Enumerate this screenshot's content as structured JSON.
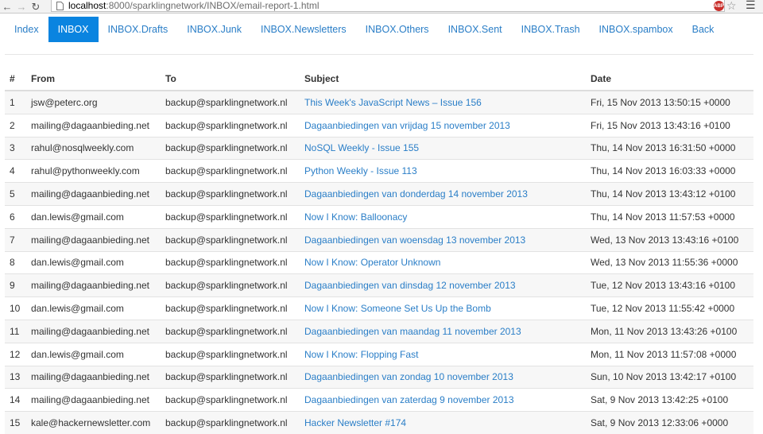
{
  "browser": {
    "url_host": "localhost",
    "url_path": ":8000/sparklingnetwork/INBOX/email-report-1.html",
    "adblock_label": "ABP",
    "colors": {
      "adblock": "#c9302c"
    },
    "icons": [
      "back-arrow-icon",
      "forward-arrow-icon",
      "reload-icon",
      "page-icon",
      "bookmark-star-icon",
      "menu-icon"
    ]
  },
  "tabs": [
    {
      "label": "Index",
      "active": false
    },
    {
      "label": "INBOX",
      "active": true
    },
    {
      "label": "INBOX.Drafts",
      "active": false
    },
    {
      "label": "INBOX.Junk",
      "active": false
    },
    {
      "label": "INBOX.Newsletters",
      "active": false
    },
    {
      "label": "INBOX.Others",
      "active": false
    },
    {
      "label": "INBOX.Sent",
      "active": false
    },
    {
      "label": "INBOX.Trash",
      "active": false
    },
    {
      "label": "INBOX.spambox",
      "active": false
    },
    {
      "label": "Back",
      "active": false
    }
  ],
  "colors": {
    "active_tab": "#0a84e0",
    "link": "#2a7ec7"
  },
  "table": {
    "headers": {
      "num": "#",
      "from": "From",
      "to": "To",
      "subject": "Subject",
      "date": "Date"
    },
    "rows": [
      {
        "num": "1",
        "from": "jsw@peterc.org",
        "to": "backup@sparklingnetwork.nl",
        "subject": "This Week's JavaScript News – Issue 156",
        "date": "Fri, 15 Nov 2013 13:50:15 +0000"
      },
      {
        "num": "2",
        "from": "mailing@dagaanbieding.net",
        "to": "backup@sparklingnetwork.nl",
        "subject": "Dagaanbiedingen van vrijdag 15 november 2013",
        "date": "Fri, 15 Nov 2013 13:43:16 +0100"
      },
      {
        "num": "3",
        "from": "rahul@nosqlweekly.com",
        "to": "backup@sparklingnetwork.nl",
        "subject": "NoSQL Weekly - Issue 155",
        "date": "Thu, 14 Nov 2013 16:31:50 +0000"
      },
      {
        "num": "4",
        "from": "rahul@pythonweekly.com",
        "to": "backup@sparklingnetwork.nl",
        "subject": "Python Weekly - Issue 113",
        "date": "Thu, 14 Nov 2013 16:03:33 +0000"
      },
      {
        "num": "5",
        "from": "mailing@dagaanbieding.net",
        "to": "backup@sparklingnetwork.nl",
        "subject": "Dagaanbiedingen van donderdag 14 november 2013",
        "date": "Thu, 14 Nov 2013 13:43:12 +0100"
      },
      {
        "num": "6",
        "from": "dan.lewis@gmail.com",
        "to": "backup@sparklingnetwork.nl",
        "subject": "Now I Know: Balloonacy",
        "date": "Thu, 14 Nov 2013 11:57:53 +0000"
      },
      {
        "num": "7",
        "from": "mailing@dagaanbieding.net",
        "to": "backup@sparklingnetwork.nl",
        "subject": "Dagaanbiedingen van woensdag 13 november 2013",
        "date": "Wed, 13 Nov 2013 13:43:16 +0100"
      },
      {
        "num": "8",
        "from": "dan.lewis@gmail.com",
        "to": "backup@sparklingnetwork.nl",
        "subject": "Now I Know: Operator Unknown",
        "date": "Wed, 13 Nov 2013 11:55:36 +0000"
      },
      {
        "num": "9",
        "from": "mailing@dagaanbieding.net",
        "to": "backup@sparklingnetwork.nl",
        "subject": "Dagaanbiedingen van dinsdag 12 november 2013",
        "date": "Tue, 12 Nov 2013 13:43:16 +0100"
      },
      {
        "num": "10",
        "from": "dan.lewis@gmail.com",
        "to": "backup@sparklingnetwork.nl",
        "subject": "Now I Know: Someone Set Us Up the Bomb",
        "date": "Tue, 12 Nov 2013 11:55:42 +0000"
      },
      {
        "num": "11",
        "from": "mailing@dagaanbieding.net",
        "to": "backup@sparklingnetwork.nl",
        "subject": "Dagaanbiedingen van maandag 11 november 2013",
        "date": "Mon, 11 Nov 2013 13:43:26 +0100"
      },
      {
        "num": "12",
        "from": "dan.lewis@gmail.com",
        "to": "backup@sparklingnetwork.nl",
        "subject": "Now I Know: Flopping Fast",
        "date": "Mon, 11 Nov 2013 11:57:08 +0000"
      },
      {
        "num": "13",
        "from": "mailing@dagaanbieding.net",
        "to": "backup@sparklingnetwork.nl",
        "subject": "Dagaanbiedingen van zondag 10 november 2013",
        "date": "Sun, 10 Nov 2013 13:42:17 +0100"
      },
      {
        "num": "14",
        "from": "mailing@dagaanbieding.net",
        "to": "backup@sparklingnetwork.nl",
        "subject": "Dagaanbiedingen van zaterdag 9 november 2013",
        "date": "Sat, 9 Nov 2013 13:42:25 +0100"
      },
      {
        "num": "15",
        "from": "kale@hackernewsletter.com",
        "to": "backup@sparklingnetwork.nl",
        "subject": "Hacker Newsletter #174",
        "date": "Sat, 9 Nov 2013 12:33:06 +0000"
      }
    ]
  }
}
